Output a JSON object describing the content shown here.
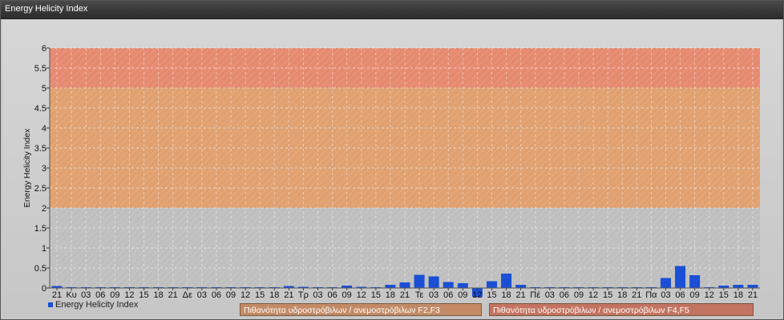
{
  "window": {
    "title": "Energy Helicity Index"
  },
  "legend": {
    "series_label": "Energy Helicity Index",
    "band_f23": "Πιθανότητα υδροστρόβιλων / ανεμοστρόβιλων F2,F3",
    "band_f45": "Πιθανότητα υδροστρόβιλων / ανεμοστρόβιλων F4,F5"
  },
  "colors": {
    "series": "#1a4fd6",
    "band_low": "#bfbfbf",
    "band_f23": "#e0a070",
    "band_f45": "#e58a70"
  },
  "chart_data": {
    "type": "bar",
    "title": "Energy Helicity Index",
    "ylabel": "Energy Helicity Index",
    "xlabel": "",
    "ylim": [
      0,
      6
    ],
    "yticks": [
      "0",
      "0.5",
      "1",
      "1.5",
      "2",
      "2.5",
      "3",
      "3.5",
      "4",
      "4.5",
      "5",
      "5.5",
      "6"
    ],
    "grid": true,
    "legend_position": "bottom-left",
    "bands": [
      {
        "from": 0,
        "to": 2,
        "label": ""
      },
      {
        "from": 2,
        "to": 5,
        "label": "Πιθανότητα υδροστρόβιλων / ανεμοστρόβιλων F2,F3"
      },
      {
        "from": 5,
        "to": 6,
        "label": "Πιθανότητα υδροστρόβιλων / ανεμοστρόβιλων F4,F5"
      }
    ],
    "categories": [
      "21",
      "Κυ",
      "03",
      "06",
      "09",
      "12",
      "15",
      "18",
      "21",
      "Δε",
      "03",
      "06",
      "09",
      "12",
      "15",
      "18",
      "21",
      "Τρ",
      "03",
      "06",
      "09",
      "12",
      "15",
      "18",
      "21",
      "Τε",
      "03",
      "06",
      "09",
      "12",
      "15",
      "18",
      "21",
      "Πέ",
      "03",
      "06",
      "09",
      "12",
      "15",
      "18",
      "21",
      "Πα",
      "03",
      "06",
      "09",
      "12",
      "15",
      "18",
      "21"
    ],
    "series": [
      {
        "name": "Energy Helicity Index",
        "values": [
          0.05,
          0.02,
          0.02,
          0.02,
          0.02,
          0.02,
          0.02,
          0.02,
          0.02,
          0.02,
          0.02,
          0.02,
          0.02,
          0.02,
          0.02,
          0.02,
          0.05,
          0.03,
          0.02,
          0.02,
          0.06,
          0.03,
          0.02,
          0.08,
          0.14,
          0.33,
          0.29,
          0.15,
          0.12,
          -0.22,
          0.17,
          0.36,
          0.08,
          0.02,
          0.02,
          0.02,
          0.02,
          0.02,
          0.02,
          0.02,
          0.02,
          0.02,
          0.25,
          0.55,
          0.32,
          0.02,
          0.06,
          0.08,
          0.08
        ]
      }
    ]
  }
}
